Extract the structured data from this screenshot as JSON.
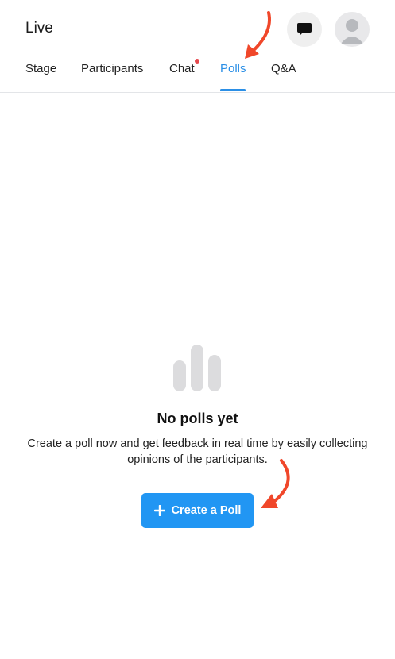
{
  "header": {
    "title": "Live",
    "chat_button_icon": "chat-bubble-icon",
    "avatar_icon": "user-avatar-icon"
  },
  "tabs": [
    {
      "label": "Stage",
      "active": false
    },
    {
      "label": "Participants",
      "active": false
    },
    {
      "label": "Chat",
      "active": false,
      "unread_dot": true
    },
    {
      "label": "Polls",
      "active": true
    },
    {
      "label": "Q&A",
      "active": false
    }
  ],
  "empty_state": {
    "icon": "bar-chart-icon",
    "heading": "No polls yet",
    "description": "Create a poll now and get feedback in real time by easily collecting opinions of the participants.",
    "button_label": "Create a Poll",
    "button_icon": "plus-icon"
  },
  "colors": {
    "accent": "#2b8fe6",
    "button": "#2196f3",
    "annotation_arrow": "#f0472a",
    "notification_dot": "#e5484d"
  }
}
